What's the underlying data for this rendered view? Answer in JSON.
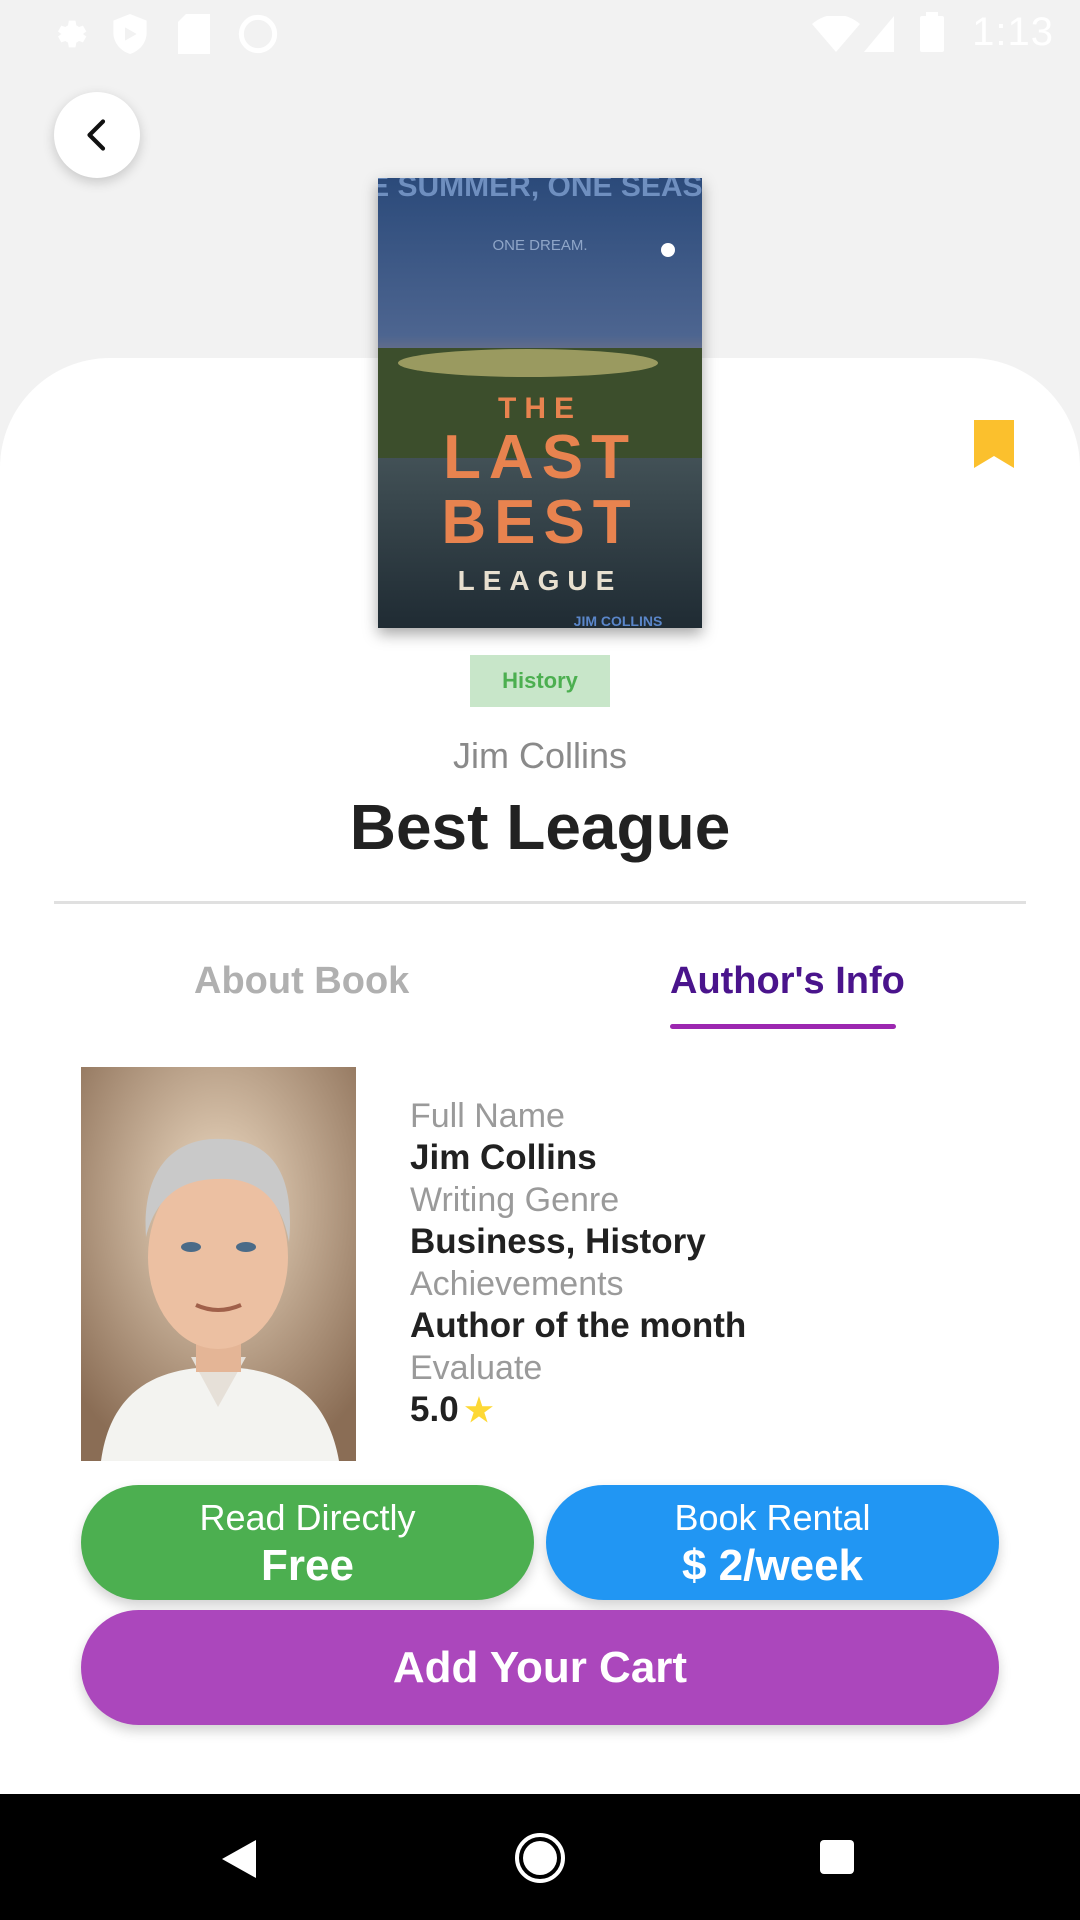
{
  "status_bar": {
    "time": "1:13",
    "icons_left": [
      "settings-icon",
      "shield-icon",
      "sd-card-icon",
      "sync-icon"
    ],
    "icons_right": [
      "wifi-icon",
      "signal-icon",
      "battery-icon"
    ]
  },
  "book": {
    "genre": "History",
    "author": "Jim Collins",
    "title": "Best League",
    "cover": {
      "top_text": "ONE SUMMER, ONE SEASON,",
      "sub_text": "ONE DREAM.",
      "title_lines": [
        "THE",
        "LAST",
        "BEST",
        "LEAGUE"
      ],
      "author_line": "JIM COLLINS"
    }
  },
  "tabs": [
    {
      "label": "About Book",
      "active": false
    },
    {
      "label": "Author's Info",
      "active": true
    }
  ],
  "author_info": {
    "full_name_label": "Full Name",
    "full_name": "Jim Collins",
    "genre_label": "Writing Genre",
    "genre": "Business, History",
    "achievements_label": "Achievements",
    "achievements": "Author of the month",
    "evaluate_label": "Evaluate",
    "rating": "5.0"
  },
  "actions": {
    "read_label": "Read Directly",
    "read_price": "Free",
    "rent_label": "Book Rental",
    "rent_price": "$ 2/week",
    "cart_label": "Add Your Cart"
  },
  "colors": {
    "accent_purple": "#9c27b0",
    "green": "#4caf50",
    "blue": "#2196f3",
    "cart": "#ab47bc",
    "bookmark": "#fbc02d"
  }
}
